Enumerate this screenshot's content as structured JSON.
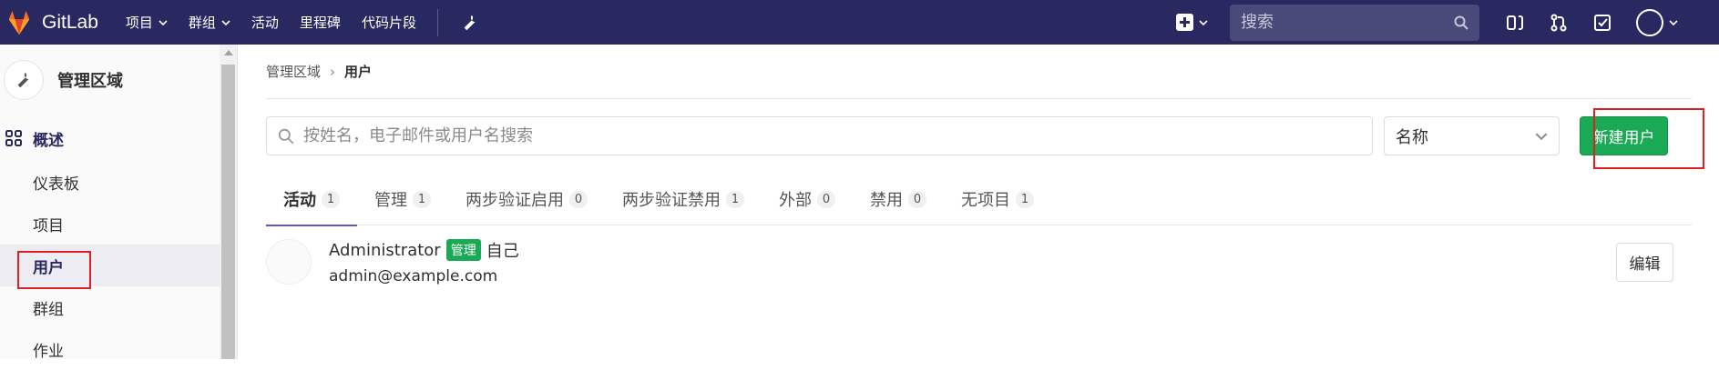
{
  "topbar": {
    "brand": "GitLab",
    "nav": [
      {
        "label": "项目",
        "dropdown": true
      },
      {
        "label": "群组",
        "dropdown": true
      },
      {
        "label": "活动",
        "dropdown": false
      },
      {
        "label": "里程碑",
        "dropdown": false
      },
      {
        "label": "代码片段",
        "dropdown": false
      }
    ],
    "search_placeholder": "搜索"
  },
  "sidebar": {
    "title": "管理区域",
    "overview_label": "概述",
    "items": [
      {
        "label": "仪表板"
      },
      {
        "label": "项目"
      },
      {
        "label": "用户"
      },
      {
        "label": "群组"
      },
      {
        "label": "作业"
      }
    ]
  },
  "breadcrumb": {
    "parent": "管理区域",
    "current": "用户"
  },
  "filter": {
    "search_placeholder": "按姓名，电子邮件或用户名搜索",
    "sort_value": "名称",
    "new_user_label": "新建用户"
  },
  "tabs": [
    {
      "label": "活动",
      "count": "1"
    },
    {
      "label": "管理",
      "count": "1"
    },
    {
      "label": "两步验证启用",
      "count": "0"
    },
    {
      "label": "两步验证禁用",
      "count": "1"
    },
    {
      "label": "外部",
      "count": "0"
    },
    {
      "label": "禁用",
      "count": "0"
    },
    {
      "label": "无项目",
      "count": "1"
    }
  ],
  "users": [
    {
      "name": "Administrator",
      "badge": "管理",
      "self_label": "自己",
      "email": "admin@example.com",
      "edit_label": "编辑"
    }
  ],
  "colors": {
    "topbar": "#292961",
    "accent_green": "#1aaa55",
    "highlight_red": "#e02020"
  }
}
